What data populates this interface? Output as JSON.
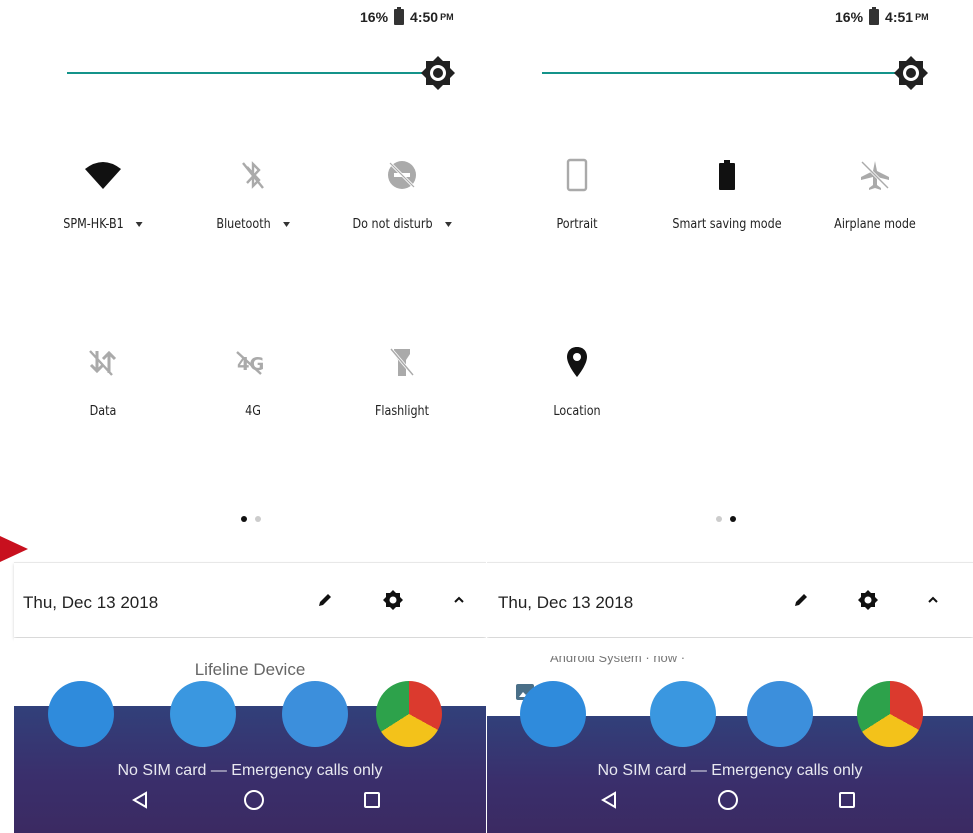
{
  "left": {
    "battery": "16%",
    "time": "4:50",
    "ampm": "PM",
    "tiles": [
      {
        "label": "SPM-HK-B1",
        "icon": "wifi-icon",
        "caret": true
      },
      {
        "label": "Bluetooth",
        "icon": "bluetooth-off-icon",
        "caret": true
      },
      {
        "label": "Do not disturb",
        "icon": "do-not-disturb-off-icon",
        "caret": true
      },
      {
        "label": "Data",
        "icon": "mobile-data-off-icon"
      },
      {
        "label": "4G",
        "icon": "4g-off-icon"
      },
      {
        "label": "Flashlight",
        "icon": "flashlight-off-icon"
      }
    ],
    "page": 1,
    "date": "Thu, Dec 13 2018",
    "notification": "Lifeline Device",
    "no_sim": "No SIM card — Emergency calls only"
  },
  "right": {
    "battery": "16%",
    "time": "4:51",
    "ampm": "PM",
    "tiles": [
      {
        "label": "Portrait",
        "icon": "portrait-icon"
      },
      {
        "label": "Smart saving mode",
        "icon": "battery-saver-icon"
      },
      {
        "label": "Airplane mode",
        "icon": "airplane-off-icon"
      },
      {
        "label": "Location",
        "icon": "location-icon"
      }
    ],
    "page": 2,
    "date": "Thu, Dec 13 2018",
    "notification": "Android System · now ·",
    "no_sim": "No SIM card — Emergency calls only"
  },
  "colors": {
    "slider": "#14938a",
    "accent_arrow": "#c8101e",
    "home_bg": "#33397a"
  }
}
